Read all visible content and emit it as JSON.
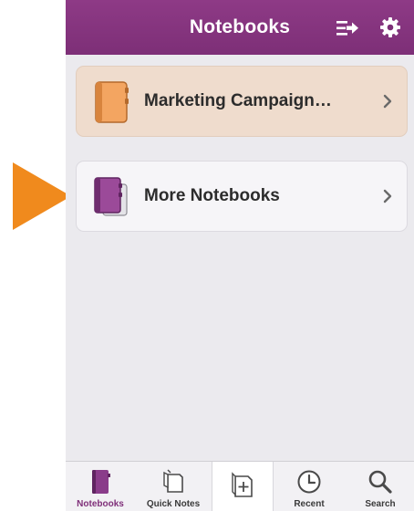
{
  "header": {
    "title": "Notebooks",
    "sync_icon": "sync-arrow-icon",
    "settings_icon": "gear-icon",
    "color": "#80307a"
  },
  "notebooks": [
    {
      "label": "Marketing Campaign…",
      "icon": "notebook-orange-icon",
      "color": "#f0a25c",
      "selected": true
    },
    {
      "label": "More Notebooks",
      "icon": "notebook-stack-purple-icon",
      "color": "#8a3c8a",
      "selected": false
    }
  ],
  "tabbar": {
    "tabs": [
      {
        "label": "Notebooks",
        "icon": "notebook-icon",
        "active": true
      },
      {
        "label": "Quick Notes",
        "icon": "quick-notes-icon",
        "active": false
      },
      {
        "label": "",
        "icon": "new-page-icon",
        "active": false
      },
      {
        "label": "Recent",
        "icon": "clock-icon",
        "active": false
      },
      {
        "label": "Search",
        "icon": "search-icon",
        "active": false
      }
    ]
  },
  "annotation": {
    "pointer_color": "#f08a1d",
    "pointer_icon": "orange-arrow-pointer"
  }
}
